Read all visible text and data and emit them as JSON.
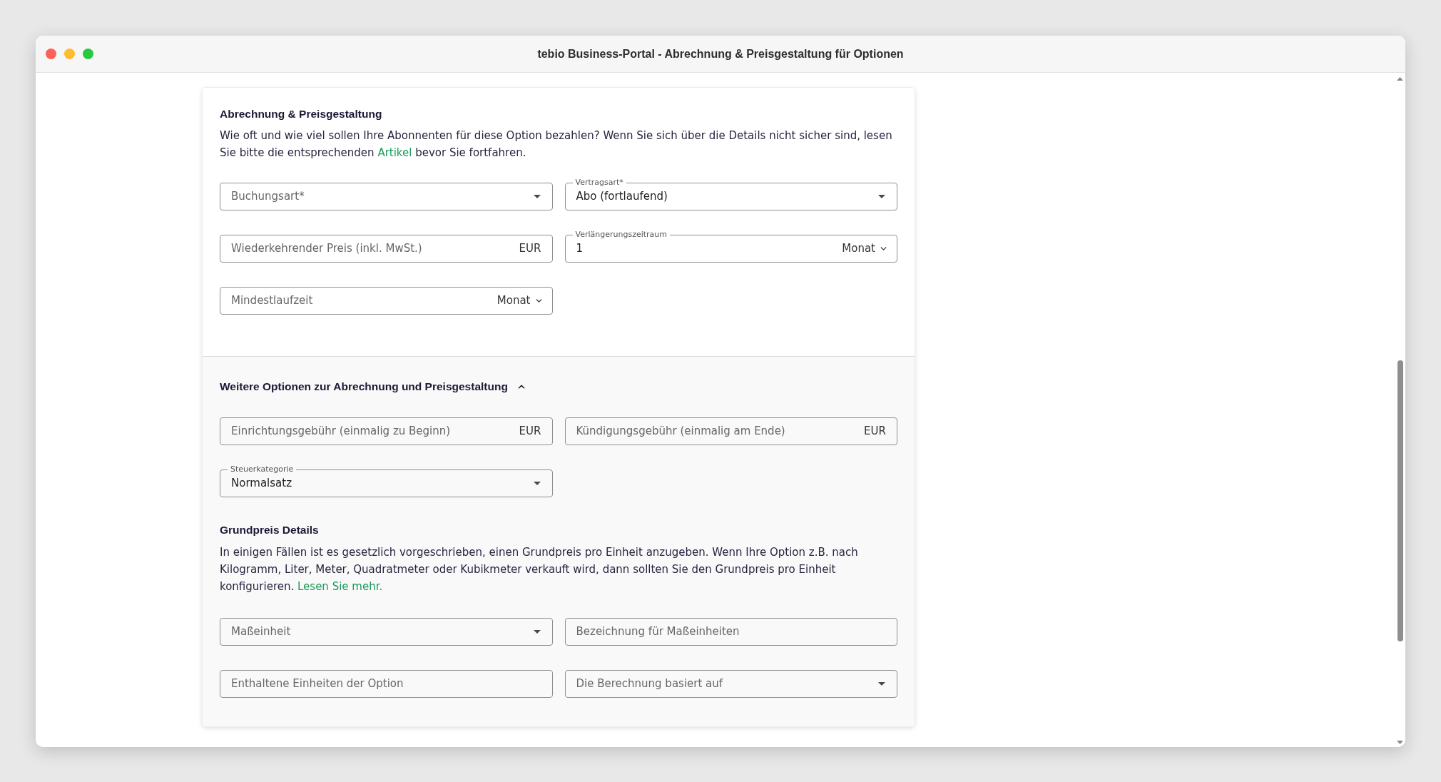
{
  "window": {
    "title": "tebio Business-Portal - Abrechnung & Preisgestaltung für Optionen"
  },
  "billing_section": {
    "heading": "Abrechnung & Preisgestaltung",
    "description": {
      "before": "Wie oft und wie viel sollen Ihre Abonnenten für diese Option bezahlen? Wenn Sie sich über die Details nicht sicher sind, lesen Sie bitte die entsprechenden",
      "link": "Artikel",
      "after": "bevor Sie fortfahren."
    },
    "fields": [
      {
        "kind": "select",
        "placeholder": "Buchungsart*"
      },
      {
        "kind": "select",
        "label": "Vertragsart*",
        "value": "Abo (fortlaufend)"
      },
      {
        "kind": "currency",
        "placeholder": "Wiederkehrender Preis (inkl. MwSt.)",
        "suffix": "EUR"
      },
      {
        "kind": "unit",
        "label": "Verlängerungszeitraum",
        "value": "1",
        "unit": "Monat"
      },
      {
        "kind": "unit",
        "placeholder": "Mindestlaufzeit",
        "unit": "Monat"
      }
    ]
  },
  "more_options_section": {
    "heading": "Weitere Optionen zur Abrechnung und Preisgestaltung",
    "expanded": true,
    "fields": [
      {
        "kind": "currency",
        "placeholder": "Einrichtungsgebühr (einmalig zu Beginn)",
        "suffix": "EUR"
      },
      {
        "kind": "currency",
        "placeholder": "Kündigungsgebühr (einmalig am Ende)",
        "suffix": "EUR"
      },
      {
        "kind": "select",
        "label": "Steuerkategorie",
        "value": "Normalsatz"
      }
    ],
    "base_price": {
      "heading": "Grundpreis Details",
      "description": {
        "before": "In einigen Fällen ist es gesetzlich vorgeschrieben, einen Grundpreis pro Einheit anzugeben. Wenn Ihre Option z.B. nach Kilogramm, Liter, Meter, Quadratmeter oder Kubikmeter verkauft wird, dann sollten Sie den Grundpreis pro Einheit konfigurieren.",
        "link": "Lesen Sie mehr."
      },
      "fields": [
        {
          "kind": "select",
          "placeholder": "Maßeinheit"
        },
        {
          "kind": "text",
          "placeholder": "Bezeichnung für Maßeinheiten"
        },
        {
          "kind": "text",
          "placeholder": "Enthaltene Einheiten der Option"
        },
        {
          "kind": "select",
          "placeholder": "Die Berechnung basiert auf"
        }
      ]
    }
  }
}
